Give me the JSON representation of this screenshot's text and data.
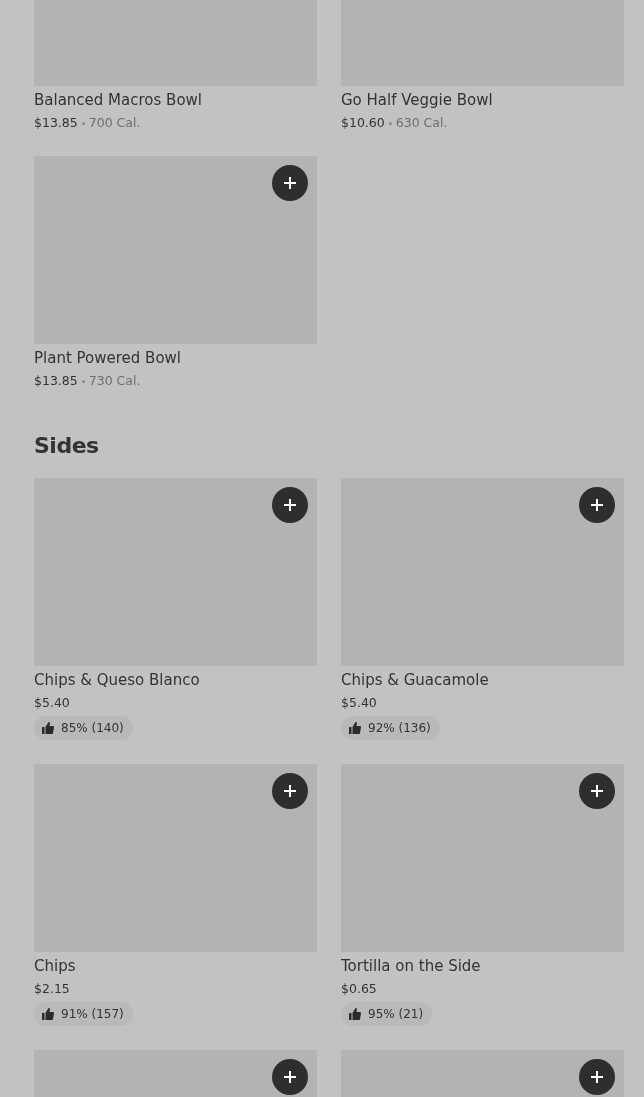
{
  "sections": [
    {
      "items": [
        {
          "kind": "dish",
          "name": "Balanced Macros Bowl",
          "price": "$13.85",
          "calories": "700 Cal."
        },
        {
          "kind": "dish",
          "name": "Go Half Veggie Bowl",
          "price": "$10.60",
          "calories": "630 Cal."
        },
        {
          "kind": "dish",
          "add_button": true,
          "name": "Plant Powered Bowl",
          "price": "$13.85",
          "calories": "730 Cal."
        }
      ]
    },
    {
      "title": "Sides",
      "items": [
        {
          "kind": "dish",
          "add_button": true,
          "name": "Chips & Queso Blanco",
          "price": "$5.40",
          "rating": "85% (140)"
        },
        {
          "kind": "dish",
          "add_button": true,
          "name": "Chips & Guacamole",
          "price": "$5.40",
          "rating": "92% (136)"
        },
        {
          "kind": "dish",
          "add_button": true,
          "name": "Chips",
          "price": "$2.15",
          "rating": "91% (157)"
        },
        {
          "kind": "dish",
          "add_button": true,
          "name": "Tortilla on the Side",
          "price": "$0.65",
          "rating": "95% (21)"
        },
        {
          "kind": "picture",
          "add_button": true
        },
        {
          "kind": "picture",
          "add_button": true
        }
      ]
    }
  ]
}
